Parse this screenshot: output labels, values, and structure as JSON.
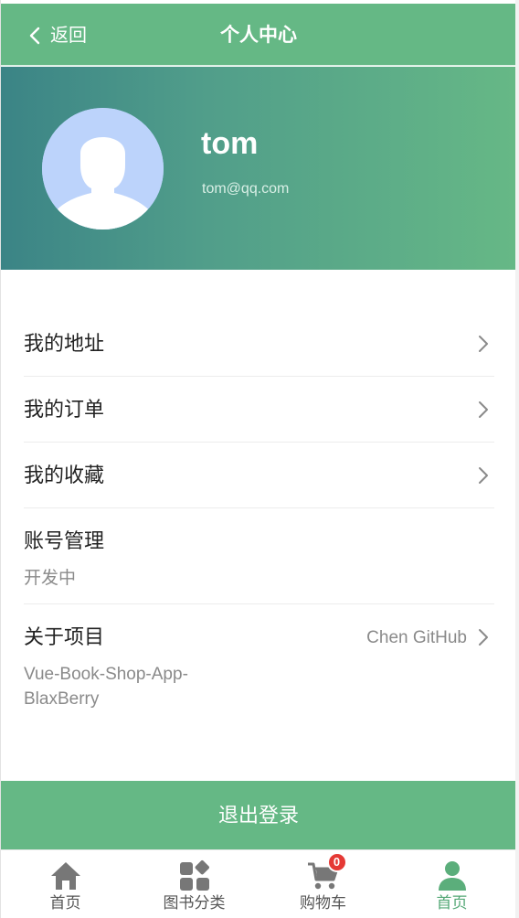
{
  "navbar": {
    "back_label": "返回",
    "title": "个人中心"
  },
  "profile": {
    "username": "tom",
    "email": "tom@qq.com"
  },
  "menu": {
    "address": {
      "label": "我的地址"
    },
    "orders": {
      "label": "我的订单"
    },
    "favorites": {
      "label": "我的收藏"
    },
    "account": {
      "label": "账号管理",
      "sub": "开发中"
    },
    "about": {
      "label": "关于项目",
      "value": "Chen GitHub",
      "sub_line1": "Vue-Book-Shop-App-",
      "sub_line2": "BlaxBerry"
    }
  },
  "logout_label": "退出登录",
  "tabbar": {
    "items": [
      {
        "label": "首页",
        "icon": "home-icon"
      },
      {
        "label": "图书分类",
        "icon": "category-grid-icon"
      },
      {
        "label": "购物车",
        "icon": "cart-icon",
        "badge": "0"
      },
      {
        "label": "首页",
        "icon": "user-icon",
        "active": true
      }
    ]
  },
  "colors": {
    "brand": "#65b885",
    "accent_text": "#54a876",
    "badge": "#e53935",
    "avatar_bg": "#bcd3fb"
  }
}
